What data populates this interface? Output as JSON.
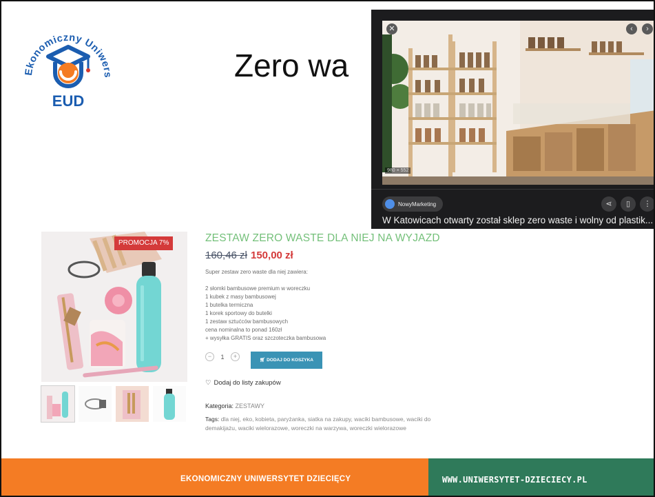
{
  "slide": {
    "title": "Zero wa"
  },
  "logo": {
    "ring_text": "Ekonomiczny Uniwersytet Dziecięcy",
    "abbr": "EUD",
    "colors": {
      "blue": "#1b5db0",
      "orange": "#f47c24",
      "red": "#d63a2f"
    }
  },
  "viewer": {
    "dims": "980 × 552",
    "source": "NowyMarketing",
    "caption": "W Katowicach otwarty został sklep zero waste i wolny od plastik..."
  },
  "product": {
    "badge": "PROMOCJA 7%",
    "title": "ZESTAW ZERO WASTE DLA NIEJ NA WYJAZD",
    "price_old": "160,46 zł",
    "price_new": "150,00 zł",
    "intro": "Super zestaw zero waste dla niej zawiera:",
    "items": [
      "2 słomki bambusowe premium w woreczku",
      "1 kubek z masy bambusowej",
      "1 butelka termiczna",
      "1 korek sportowy do butelki",
      "1 zestaw sztućców bambusowych",
      "cena nominalna to ponad 160zł",
      "+ wysyłka GRATIS oraz szczoteczka bambusowa"
    ],
    "quantity": "1",
    "cart_label": "DODAJ DO KOSZYKA",
    "wishlist_label": "Dodaj do listy zakupów",
    "category_label": "Kategoria:",
    "category_value": "ZESTAWY",
    "tags_label": "Tags:",
    "tags_value": "dla niej, eko, kobieta, paryżanka, siatka na zakupy, waciki bambusowe, waciki do demakijażu, waciki wielorazowe, woreczki na warzywa, woreczki wielorazowe"
  },
  "footer": {
    "left": "EKONOMICZNY UNIWERSYTET DZIECIĘCY",
    "right": "WWW.UNIWERSYTET-DZIECIECY.PL",
    "left_color": "#f47c24",
    "right_color": "#2f7a5a"
  }
}
